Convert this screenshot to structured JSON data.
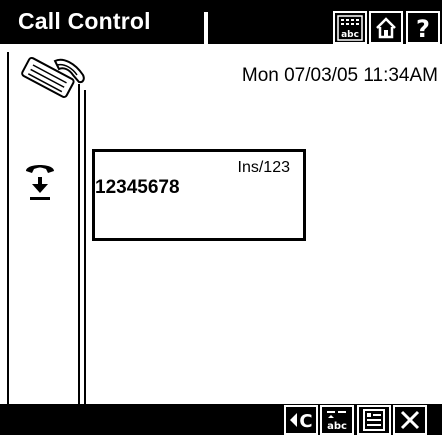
{
  "header": {
    "title": "Call Control",
    "buttons": [
      {
        "icon": "keyboard-abc-icon"
      },
      {
        "icon": "home-icon"
      },
      {
        "icon": "help-icon"
      }
    ]
  },
  "status": {
    "datetime": "Mon 07/03/05 11:34AM",
    "call_icon": "phone-handset-icon",
    "hold_icon": "hold-call-icon"
  },
  "entry": {
    "mode": "Ins/123",
    "number": "12345678"
  },
  "softkeys": [
    {
      "icon": "backspace-clear-icon"
    },
    {
      "icon": "text-mode-abc-icon"
    },
    {
      "icon": "menu-list-icon"
    },
    {
      "icon": "close-icon"
    }
  ],
  "colors": {
    "bar": "#000000",
    "foreground": "#ffffff",
    "background": "#ffffff",
    "text": "#000000"
  }
}
